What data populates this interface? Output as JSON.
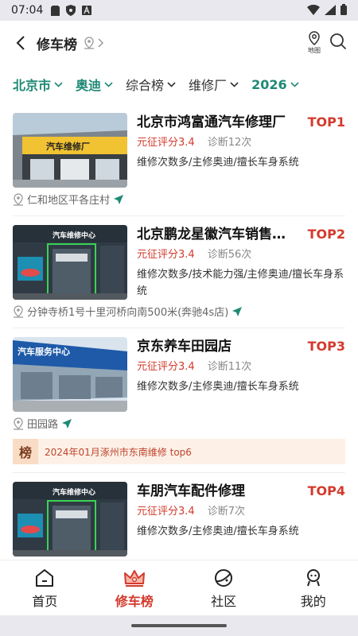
{
  "status_bar": {
    "time": "07:04"
  },
  "header": {
    "title": "修车榜",
    "map_label": "地图"
  },
  "filters": [
    {
      "label": "北京市",
      "active": true
    },
    {
      "label": "奥迪",
      "active": true
    },
    {
      "label": "综合榜",
      "active": false
    },
    {
      "label": "维修厂",
      "active": false
    },
    {
      "label": "2026",
      "active": true
    }
  ],
  "shops": [
    {
      "name": "北京市鸿富通汽车修理厂",
      "rank": "TOP1",
      "score": "元征评分3.4",
      "visits": "诊断12次",
      "tags": "维修次数多/主修奥迪/擅长车身系统",
      "address": "仁和地区平各庄村",
      "image_sign": "汽车维修厂"
    },
    {
      "name": "北京鹏龙星徽汽车销售…",
      "rank": "TOP2",
      "score": "元征评分3.4",
      "visits": "诊断56次",
      "tags": "维修次数多/技术能力强/主修奥迪/擅长车身系统",
      "address": "分钟寺桥1号十里河桥向南500米(奔驰4s店)",
      "image_sign": "汽车维修中心"
    },
    {
      "name": "京东养车田园店",
      "rank": "TOP3",
      "score": "元征评分3.4",
      "visits": "诊断11次",
      "tags": "维修次数多/主修奥迪/擅长车身系统",
      "address": "田园路",
      "image_sign": "汽车服务中心"
    },
    {
      "name": "车朋汽车配件修理",
      "rank": "TOP4",
      "score": "元征评分3.4",
      "visits": "诊断7次",
      "tags": "维修次数多/主修奥迪/擅长车身系统",
      "image_sign": "汽车维修中心"
    }
  ],
  "banner": {
    "badge": "榜",
    "text": "2024年01月涿州市东南维修 top6"
  },
  "tabbar": [
    {
      "label": "首页",
      "icon": "home-icon",
      "active": false
    },
    {
      "label": "修车榜",
      "icon": "crown-icon",
      "active": true
    },
    {
      "label": "社区",
      "icon": "planet-icon",
      "active": false
    },
    {
      "label": "我的",
      "icon": "user-icon",
      "active": false
    }
  ],
  "colors": {
    "accent_green": "#1f8a76",
    "rank_red": "#d33a2c",
    "banner_bg": "#fdf1e7"
  }
}
